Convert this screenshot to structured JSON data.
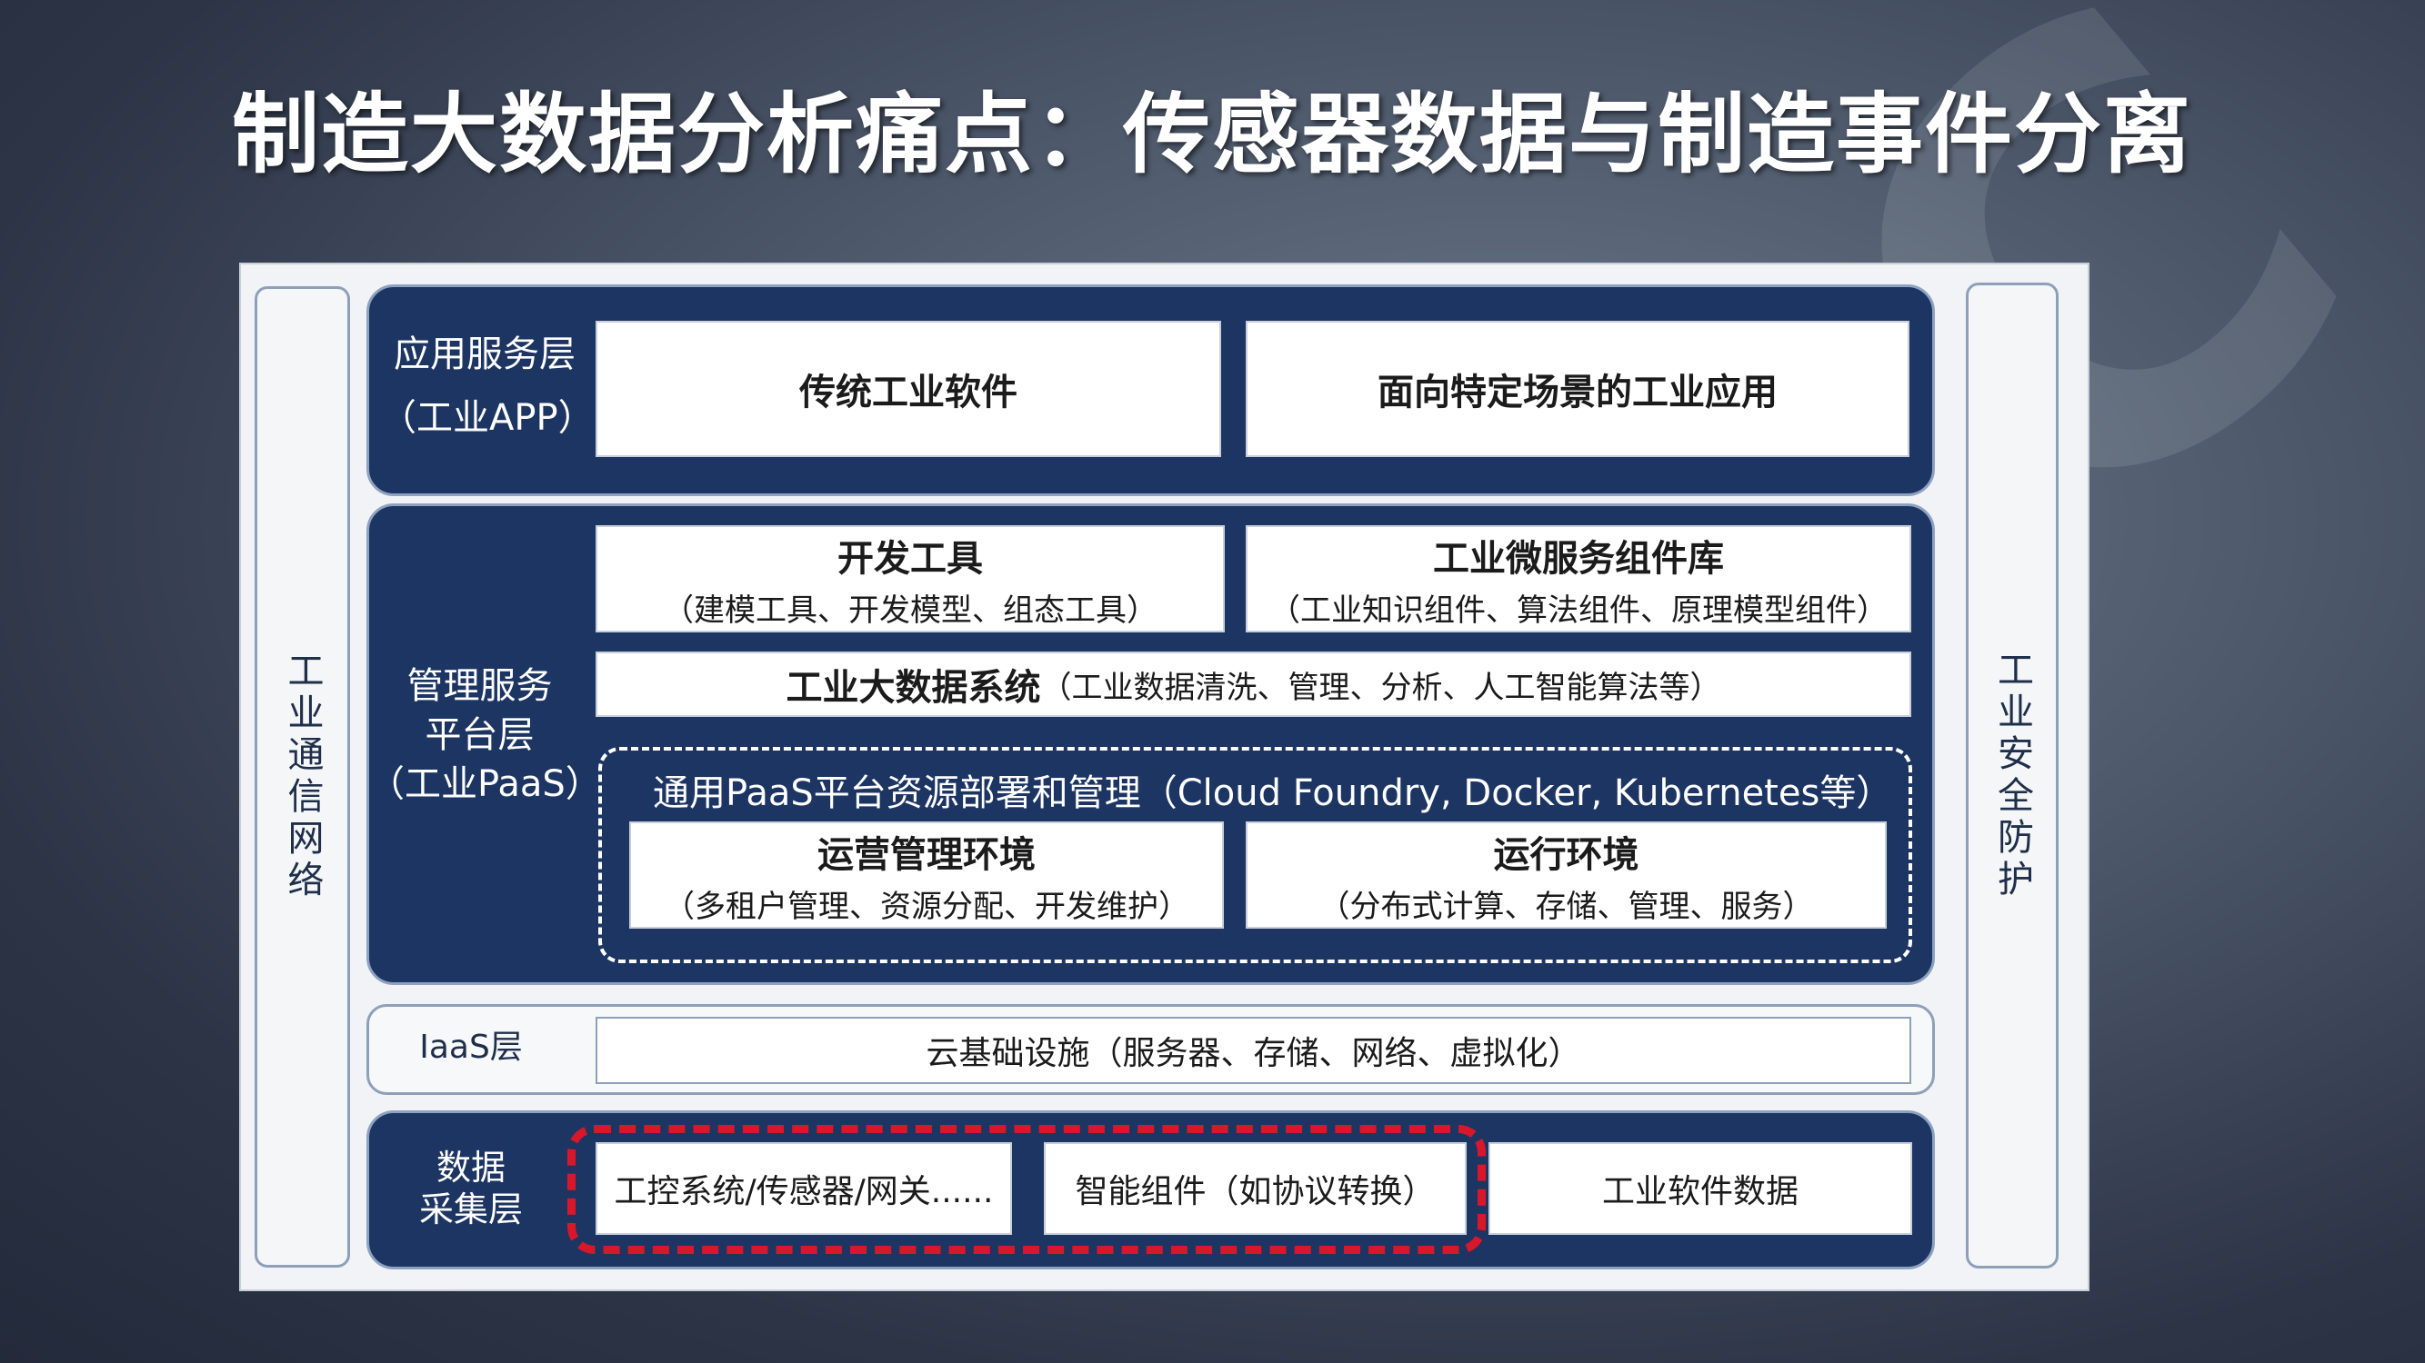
{
  "title": "制造大数据分析痛点：传感器数据与制造事件分离",
  "left_column": "工业通信网络",
  "right_column": "工业安全防护",
  "app_layer": {
    "label_line1": "应用服务层",
    "label_line2": "（工业APP）",
    "box1": "传统工业软件",
    "box2": "面向特定场景的工业应用"
  },
  "paas_layer": {
    "label_line1": "管理服务",
    "label_line2": "平台层",
    "label_line3": "（工业PaaS）",
    "dev_tools_title": "开发工具",
    "dev_tools_sub": "（建模工具、开发模型、组态工具）",
    "micro_title": "工业微服务组件库",
    "micro_sub": "（工业知识组件、算法组件、原理模型组件）",
    "bigdata_title": "工业大数据系统",
    "bigdata_sub": "（工业数据清洗、管理、分析、人工智能算法等）",
    "resource_caption": "通用PaaS平台资源部署和管理（Cloud Foundry, Docker, Kubernetes等）",
    "ops_title": "运营管理环境",
    "ops_sub": "（多租户管理、资源分配、开发维护）",
    "runtime_title": "运行环境",
    "runtime_sub": "（分布式计算、存储、管理、服务）"
  },
  "iaas_layer": {
    "label": "IaaS层",
    "content": "云基础设施（服务器、存储、网络、虚拟化）"
  },
  "data_layer": {
    "label_line1": "数据",
    "label_line2": "采集层",
    "box1": "工控系统/传感器/网关......",
    "box2": "智能组件（如协议转换）",
    "box3": "工业软件数据"
  },
  "colors": {
    "layer_fill": "#1d3563",
    "highlight_dash": "#d8182a"
  }
}
